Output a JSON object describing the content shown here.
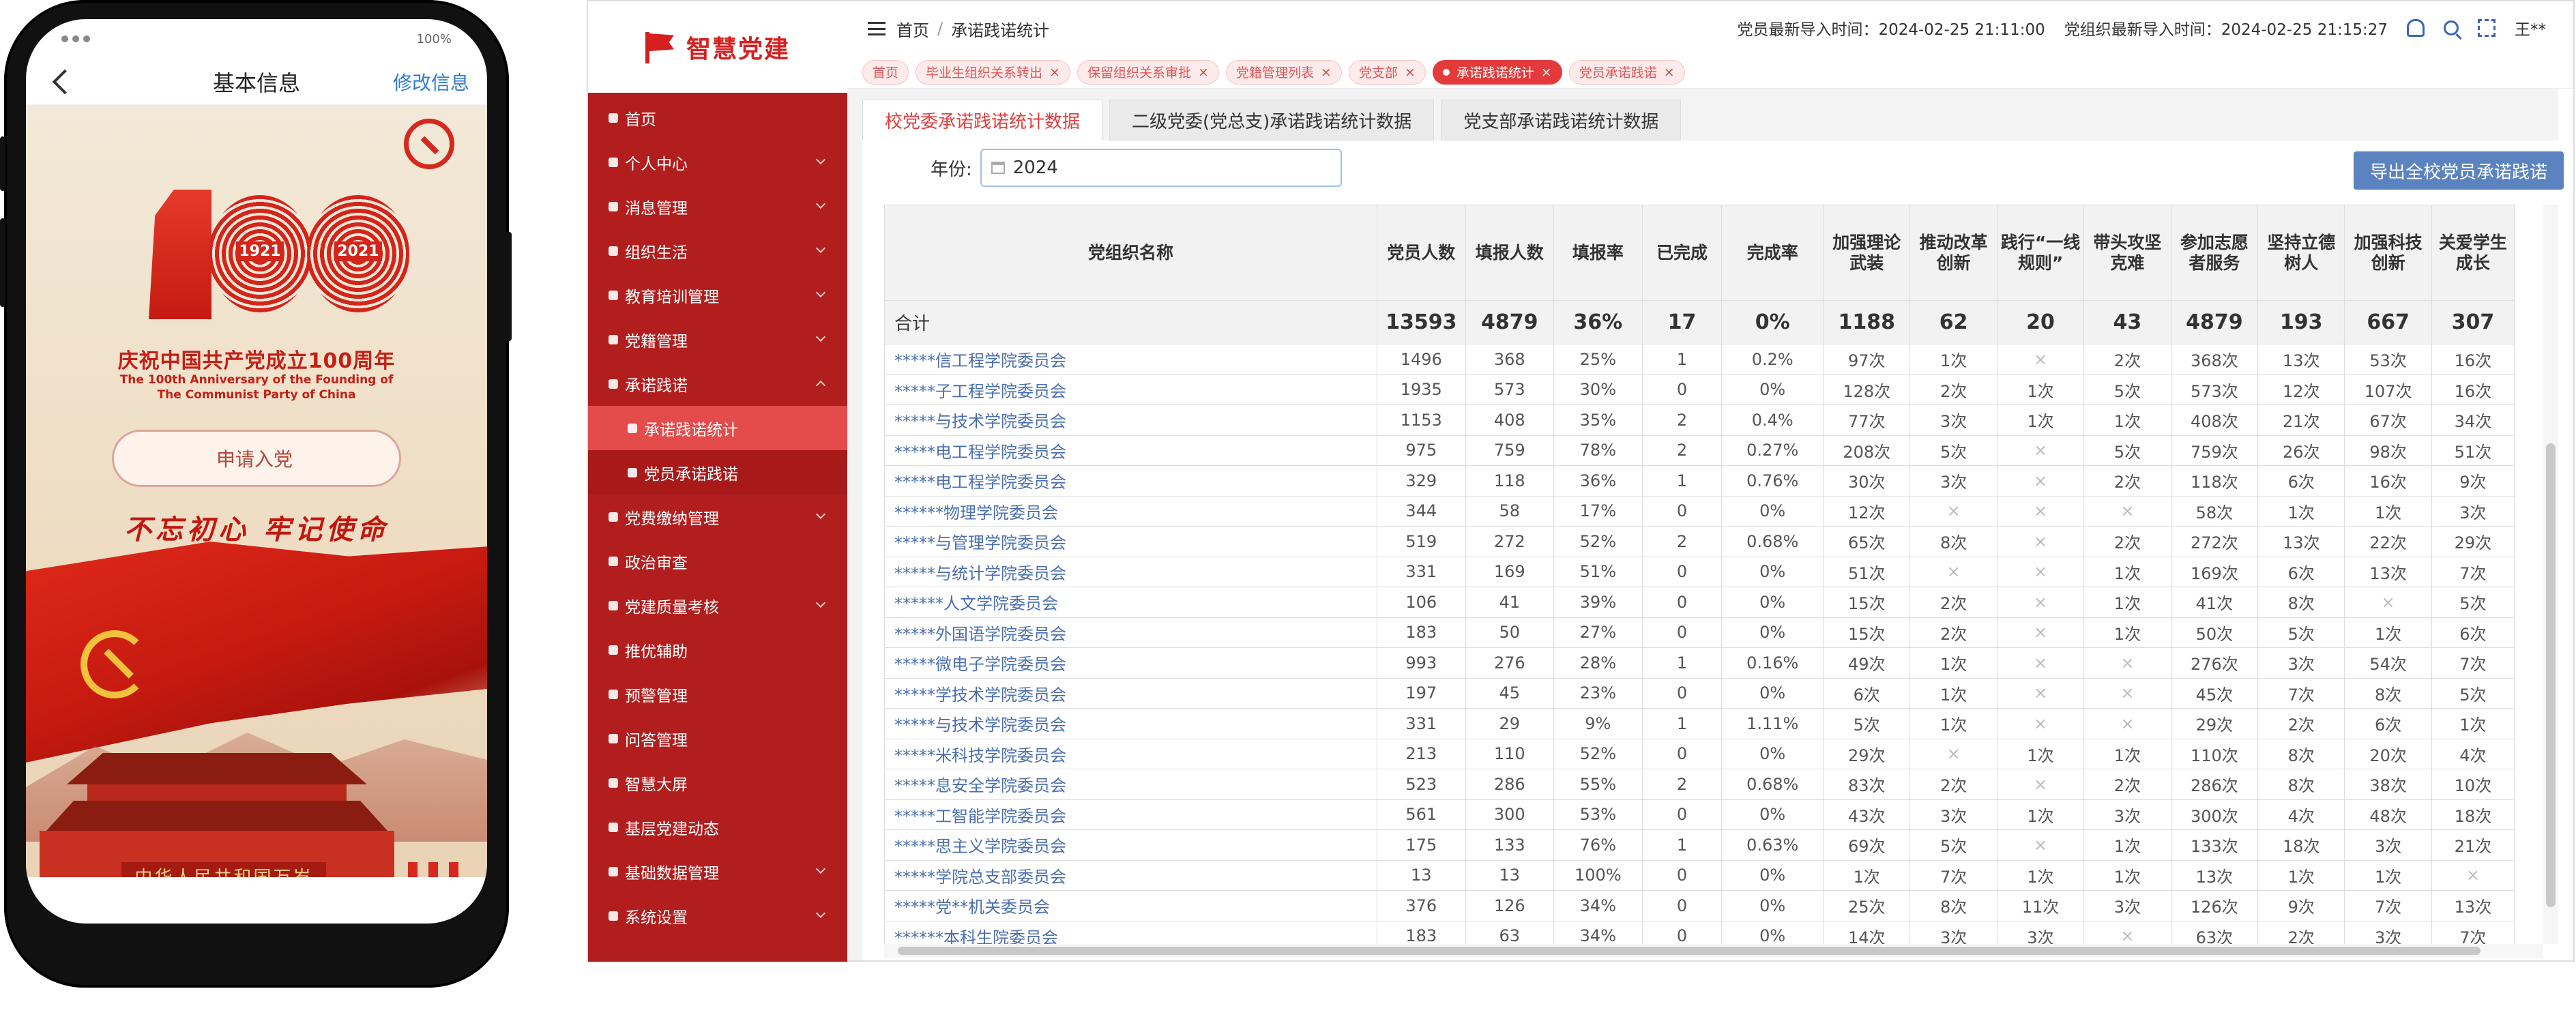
{
  "phone": {
    "status_battery": "100%",
    "title": "基本信息",
    "edit_label": "修改信息",
    "poster": {
      "logo_number": "100",
      "logo_year_start": "1921",
      "logo_year_end": "2021",
      "title_cn": "庆祝中国共产党成立100周年",
      "title_en_line1": "The 100th Anniversary of the Founding of",
      "title_en_line2": "The Communist Party of China",
      "apply_button": "申请入党",
      "slogan": "不忘初心  牢记使命",
      "gate_sign": "中华人民共和国万岁"
    }
  },
  "app": {
    "brand": "智慧党建",
    "breadcrumb": {
      "home": "首页",
      "current": "承诺践诺统计"
    },
    "header": {
      "member_import": "党员最新导入时间：2024-02-25 21:11:00",
      "org_import": "党组织最新导入时间：2024-02-25 21:15:27",
      "user": "王**"
    },
    "visited_tabs": [
      {
        "label": "首页",
        "closable": false
      },
      {
        "label": "毕业生组织关系转出",
        "closable": true
      },
      {
        "label": "保留组织关系审批",
        "closable": true
      },
      {
        "label": "党籍管理列表",
        "closable": true
      },
      {
        "label": "党支部",
        "closable": true
      },
      {
        "label": "承诺践诺统计",
        "closable": true,
        "active": true
      },
      {
        "label": "党员承诺践诺",
        "closable": true
      }
    ],
    "menu": [
      {
        "label": "首页",
        "expandable": false
      },
      {
        "label": "个人中心",
        "expandable": true
      },
      {
        "label": "消息管理",
        "expandable": true
      },
      {
        "label": "组织生活",
        "expandable": true
      },
      {
        "label": "教育培训管理",
        "expandable": true
      },
      {
        "label": "党籍管理",
        "expandable": true
      },
      {
        "label": "承诺践诺",
        "expandable": true,
        "open": true
      },
      {
        "label": "承诺践诺统计",
        "sub": true,
        "active": true
      },
      {
        "label": "党员承诺践诺",
        "sub": true
      },
      {
        "label": "党费缴纳管理",
        "expandable": true
      },
      {
        "label": "政治审查",
        "expandable": false
      },
      {
        "label": "党建质量考核",
        "expandable": true
      },
      {
        "label": "推优辅助",
        "expandable": false
      },
      {
        "label": "预警管理",
        "expandable": false
      },
      {
        "label": "问答管理",
        "expandable": false
      },
      {
        "label": "智慧大屏",
        "expandable": false
      },
      {
        "label": "基层党建动态",
        "expandable": false
      },
      {
        "label": "基础数据管理",
        "expandable": true
      },
      {
        "label": "系统设置",
        "expandable": true
      }
    ],
    "sub_tabs": [
      "校党委承诺践诺统计数据",
      "二级党委(党总支)承诺践诺统计数据",
      "党支部承诺践诺统计数据"
    ],
    "filter": {
      "label": "年份:",
      "value": "2024"
    },
    "export_button": "导出全校党员承诺践诺",
    "table": {
      "columns": [
        "党组织名称",
        "党员人数",
        "填报人数",
        "填报率",
        "已完成",
        "完成率",
        "加强理论武装",
        "推动改革创新",
        "践行“一线规则”",
        "带头攻坚克难",
        "参加志愿者服务",
        "坚持立德树人",
        "加强科技创新",
        "关爱学生成长"
      ],
      "total": [
        "合计",
        "13593",
        "4879",
        "36%",
        "17",
        "0%",
        "1188",
        "62",
        "20",
        "43",
        "4879",
        "193",
        "667",
        "307"
      ],
      "rows": [
        [
          "*****信工程学院委员会",
          "1496",
          "368",
          "25%",
          "1",
          "0.2%",
          "97次",
          "1次",
          "×",
          "2次",
          "368次",
          "13次",
          "53次",
          "16次"
        ],
        [
          "*****子工程学院委员会",
          "1935",
          "573",
          "30%",
          "0",
          "0%",
          "128次",
          "2次",
          "1次",
          "5次",
          "573次",
          "12次",
          "107次",
          "16次"
        ],
        [
          "*****与技术学院委员会",
          "1153",
          "408",
          "35%",
          "2",
          "0.4%",
          "77次",
          "3次",
          "1次",
          "1次",
          "408次",
          "21次",
          "67次",
          "34次"
        ],
        [
          "*****电工程学院委员会",
          "975",
          "759",
          "78%",
          "2",
          "0.27%",
          "208次",
          "5次",
          "×",
          "5次",
          "759次",
          "26次",
          "98次",
          "51次"
        ],
        [
          "*****电工程学院委员会",
          "329",
          "118",
          "36%",
          "1",
          "0.76%",
          "30次",
          "3次",
          "×",
          "2次",
          "118次",
          "6次",
          "16次",
          "9次"
        ],
        [
          "******物理学院委员会",
          "344",
          "58",
          "17%",
          "0",
          "0%",
          "12次",
          "×",
          "×",
          "×",
          "58次",
          "1次",
          "1次",
          "3次"
        ],
        [
          "*****与管理学院委员会",
          "519",
          "272",
          "52%",
          "2",
          "0.68%",
          "65次",
          "8次",
          "×",
          "2次",
          "272次",
          "13次",
          "22次",
          "29次"
        ],
        [
          "*****与统计学院委员会",
          "331",
          "169",
          "51%",
          "0",
          "0%",
          "51次",
          "×",
          "×",
          "1次",
          "169次",
          "6次",
          "13次",
          "7次"
        ],
        [
          "******人文学院委员会",
          "106",
          "41",
          "39%",
          "0",
          "0%",
          "15次",
          "2次",
          "×",
          "1次",
          "41次",
          "8次",
          "×",
          "5次"
        ],
        [
          "*****外国语学院委员会",
          "183",
          "50",
          "27%",
          "0",
          "0%",
          "15次",
          "2次",
          "×",
          "1次",
          "50次",
          "5次",
          "1次",
          "6次"
        ],
        [
          "*****微电子学院委员会",
          "993",
          "276",
          "28%",
          "1",
          "0.16%",
          "49次",
          "1次",
          "×",
          "×",
          "276次",
          "3次",
          "54次",
          "7次"
        ],
        [
          "*****学技术学院委员会",
          "197",
          "45",
          "23%",
          "0",
          "0%",
          "6次",
          "1次",
          "×",
          "×",
          "45次",
          "7次",
          "8次",
          "5次"
        ],
        [
          "*****与技术学院委员会",
          "331",
          "29",
          "9%",
          "1",
          "1.11%",
          "5次",
          "1次",
          "×",
          "×",
          "29次",
          "2次",
          "6次",
          "1次"
        ],
        [
          "*****米科技学院委员会",
          "213",
          "110",
          "52%",
          "0",
          "0%",
          "29次",
          "×",
          "1次",
          "1次",
          "110次",
          "8次",
          "20次",
          "4次"
        ],
        [
          "*****息安全学院委员会",
          "523",
          "286",
          "55%",
          "2",
          "0.68%",
          "83次",
          "2次",
          "×",
          "2次",
          "286次",
          "8次",
          "38次",
          "10次"
        ],
        [
          "*****工智能学院委员会",
          "561",
          "300",
          "53%",
          "0",
          "0%",
          "43次",
          "3次",
          "1次",
          "3次",
          "300次",
          "4次",
          "48次",
          "18次"
        ],
        [
          "*****思主义学院委员会",
          "175",
          "133",
          "76%",
          "1",
          "0.63%",
          "69次",
          "5次",
          "×",
          "1次",
          "133次",
          "18次",
          "3次",
          "21次"
        ],
        [
          "*****学院总支部委员会",
          "13",
          "13",
          "100%",
          "0",
          "0%",
          "1次",
          "7次",
          "1次",
          "1次",
          "13次",
          "1次",
          "1次",
          "×"
        ],
        [
          "*****党**机关委员会",
          "376",
          "126",
          "34%",
          "0",
          "0%",
          "25次",
          "8次",
          "11次",
          "3次",
          "126次",
          "9次",
          "7次",
          "13次"
        ],
        [
          "******本科生院委员会",
          "183",
          "63",
          "34%",
          "0",
          "0%",
          "14次",
          "3次",
          "3次",
          "×",
          "63次",
          "2次",
          "3次",
          "7次"
        ]
      ]
    }
  }
}
